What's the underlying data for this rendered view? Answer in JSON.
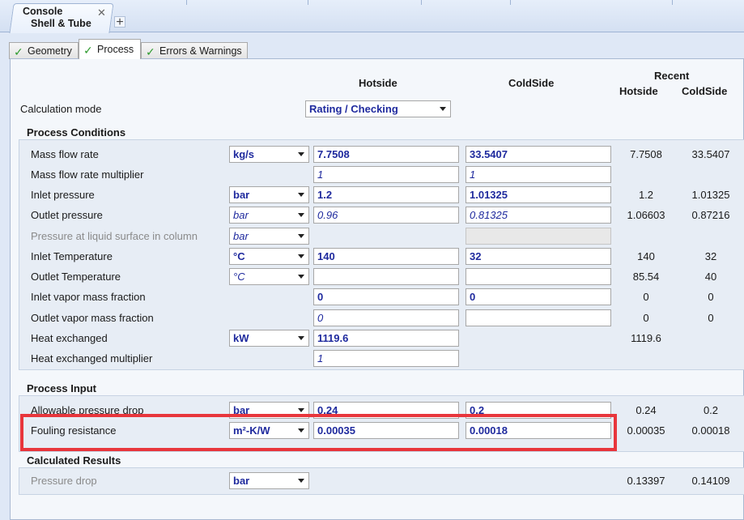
{
  "doc_tab": {
    "line1": "Console",
    "line2": "Shell & Tube",
    "close": "✕",
    "add": "+"
  },
  "tabs": [
    {
      "label": "Geometry"
    },
    {
      "label": "Process"
    },
    {
      "label": "Errors & Warnings"
    }
  ],
  "headers": {
    "hotside": "Hotside",
    "coldside": "ColdSide",
    "recent": "Recent",
    "recent_hot": "Hotside",
    "recent_cold": "ColdSide"
  },
  "calc_mode": {
    "label": "Calculation mode",
    "value": "Rating / Checking"
  },
  "sections": {
    "process_conditions": "Process Conditions",
    "process_input": "Process Input",
    "calculated_results": "Calculated Results"
  },
  "rows": {
    "mass_flow": {
      "label": "Mass flow rate",
      "unit": "kg/s",
      "hot": "7.7508",
      "cold": "33.5407",
      "recent_hot": "7.7508",
      "recent_cold": "33.5407"
    },
    "mass_flow_mult": {
      "label": "Mass flow rate multiplier",
      "hot": "1",
      "cold": "1"
    },
    "inlet_pressure": {
      "label": "Inlet pressure",
      "unit": "bar",
      "hot": "1.2",
      "cold": "1.01325",
      "recent_hot": "1.2",
      "recent_cold": "1.01325"
    },
    "outlet_pressure": {
      "label": "Outlet pressure",
      "unit": "bar",
      "hot": "0.96",
      "cold": "0.81325",
      "recent_hot": "1.06603",
      "recent_cold": "0.87216"
    },
    "pressure_liquid": {
      "label": "Pressure at liquid surface in column",
      "unit": "bar"
    },
    "inlet_temp": {
      "label": "Inlet Temperature",
      "unit": "°C",
      "hot": "140",
      "cold": "32",
      "recent_hot": "140",
      "recent_cold": "32"
    },
    "outlet_temp": {
      "label": "Outlet Temperature",
      "unit": "°C",
      "recent_hot": "85.54",
      "recent_cold": "40"
    },
    "inlet_vapor": {
      "label": "Inlet vapor mass fraction",
      "hot": "0",
      "cold": "0",
      "recent_hot": "0",
      "recent_cold": "0"
    },
    "outlet_vapor": {
      "label": "Outlet vapor mass fraction",
      "hot": "0",
      "recent_hot": "0",
      "recent_cold": "0"
    },
    "heat_exchanged": {
      "label": "Heat exchanged",
      "unit": "kW",
      "hot": "1119.6",
      "recent_hot": "1119.6"
    },
    "heat_mult": {
      "label": "Heat exchanged multiplier",
      "hot": "1"
    },
    "allowable_dp": {
      "label": "Allowable pressure drop",
      "unit": "bar",
      "hot": "0.24",
      "cold": "0.2",
      "recent_hot": "0.24",
      "recent_cold": "0.2"
    },
    "fouling": {
      "label": "Fouling resistance",
      "unit": "m²-K/W",
      "hot": "0.00035",
      "cold": "0.00018",
      "recent_hot": "0.00035",
      "recent_cold": "0.00018"
    },
    "pressure_drop": {
      "label": "Pressure drop",
      "unit": "bar",
      "recent_hot": "0.13397",
      "recent_cold": "0.14109"
    }
  }
}
